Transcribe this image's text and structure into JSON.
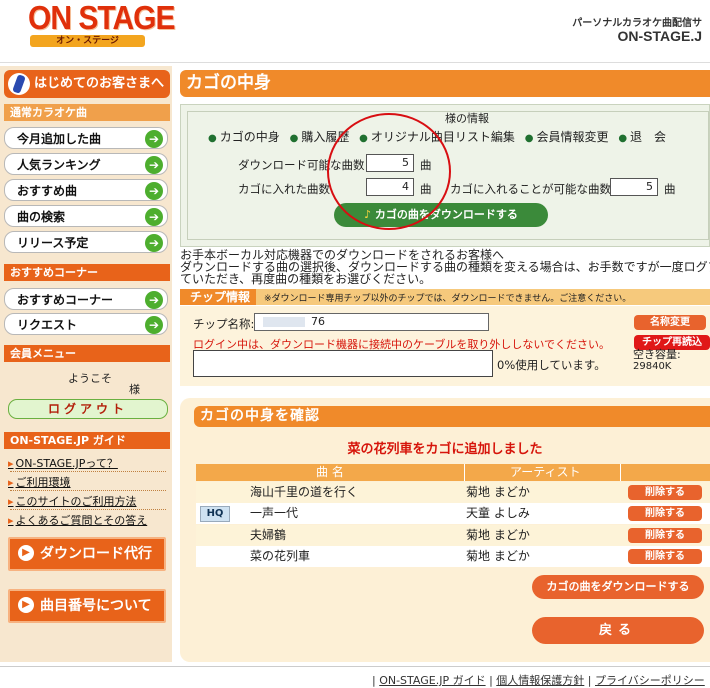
{
  "header": {
    "logo_text": "ON STAGE",
    "logo_sub": "オン・ステージ",
    "tagline": "パーソナルカラオケ曲配信サ",
    "site_name": "ON-STAGE.J"
  },
  "sidebar": {
    "first_visit": "はじめてのお客さまへ",
    "karaoke_section": "通常カラオケ曲",
    "karaoke_items": [
      "今月追加した曲",
      "人気ランキング",
      "おすすめ曲",
      "曲の検索",
      "リリース予定"
    ],
    "recommend_section": "おすすめコーナー",
    "recommend_items": [
      "おすすめコーナー",
      "リクエスト"
    ],
    "member_section": "会員メニュー",
    "welcome": "ようこそ",
    "user_suffix": "様",
    "logout": "ログアウト",
    "guide_section": "ON-STAGE.JP ガイド",
    "guide_links": [
      "ON-STAGE.JPって？",
      "ご利用環境",
      "このサイトのご利用方法",
      "よくあるご質問とその答え"
    ],
    "download_agent": "ダウンロード代行",
    "track_number": "曲目番号について"
  },
  "main": {
    "title": "カゴの中身",
    "member_info": "様の情報",
    "tabs": [
      "カゴの中身",
      "購入履歴",
      "オリジナル曲目リスト編集",
      "会員情報変更",
      "退　会"
    ],
    "downloadable_label": "ダウンロード可能な曲数",
    "downloadable_value": "5",
    "in_cart_label": "カゴに入れた曲数",
    "in_cart_value": "4",
    "can_add_label": "カゴに入れることが可能な曲数",
    "can_add_value": "5",
    "unit": "曲",
    "download_button": "カゴの曲をダウンロードする",
    "notice_lines": [
      "お手本ボーカル対応機器でのダウンロードをされるお客様へ",
      "ダウンロードする曲の選択後、ダウンロードする曲の種類を変える場合は、お手数ですが一度ログアウト",
      "ていただき、再度曲の種類をお選びください。"
    ]
  },
  "chip": {
    "header": "チップ情報",
    "header_note": "※ダウンロード専用チップ以外のチップでは、ダウンロードできません。ご注意ください。",
    "name_label": "チップ名称:",
    "name_value": "76",
    "rename_button": "名称変更",
    "warning": "ログイン中は、ダウンロード機器に接続中のケーブルを取り外ししないでください。",
    "reread_button": "チップ再読込",
    "usage_text": "0%使用しています。",
    "free_label": "空き容量:",
    "free_value": "29840K"
  },
  "cart": {
    "header": "カゴの中身を確認",
    "added_message": "菜の花列車をカゴに追加しました",
    "col_title": "曲 名",
    "col_artist": "アーティスト",
    "delete_label": "削除する",
    "rows": [
      {
        "title": "海山千里の道を行く",
        "artist": "菊地 まどか",
        "hq": ""
      },
      {
        "title": "一声一代",
        "artist": "天童 よしみ",
        "hq": "HQ"
      },
      {
        "title": "夫婦鶴",
        "artist": "菊地 まどか",
        "hq": ""
      },
      {
        "title": "菜の花列車",
        "artist": "菊地 まどか",
        "hq": ""
      }
    ],
    "download_button": "カゴの曲をダウンロードする",
    "back_button": "戻る"
  },
  "footer": {
    "links": [
      "ON-STAGE.JP ガイド",
      "個人情報保護方針",
      "プライバシーポリシー"
    ]
  },
  "colors": {
    "accent": "#e8631a",
    "green": "#3b8a3a",
    "alert": "#d80e12"
  }
}
